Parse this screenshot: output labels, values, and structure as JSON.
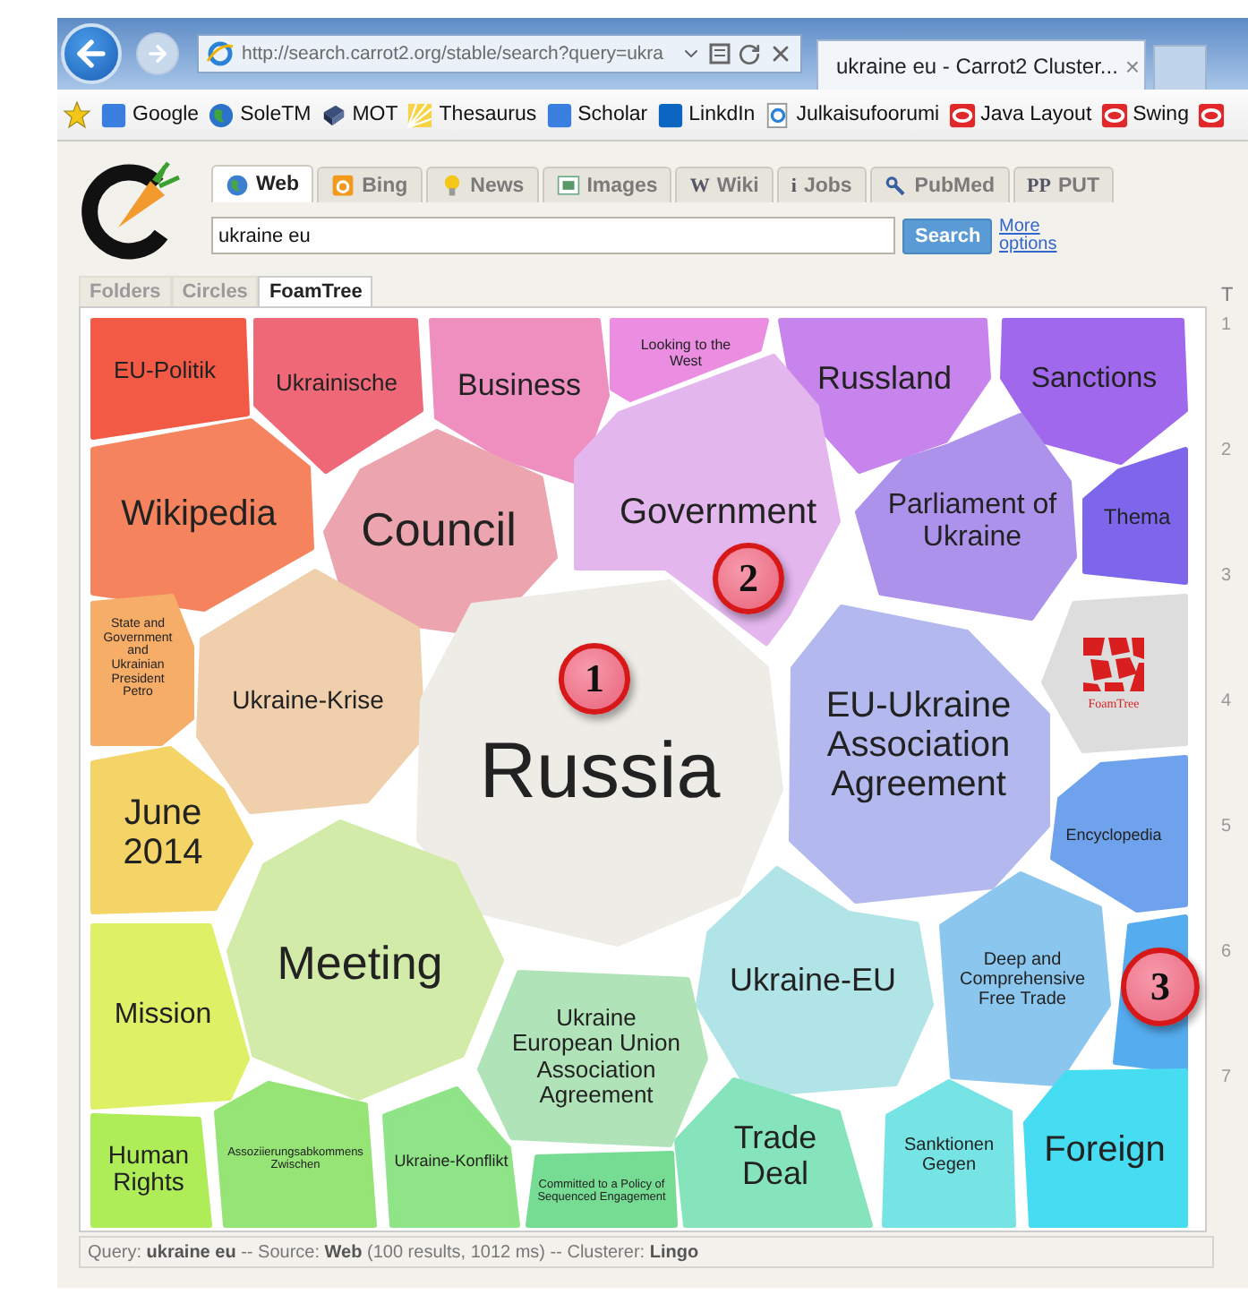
{
  "browser": {
    "address": "http://search.carrot2.org/stable/search?query=ukra",
    "tab": {
      "title": "ukraine eu - Carrot2 Cluster...",
      "close": "×"
    }
  },
  "favorites": [
    {
      "label": "Google"
    },
    {
      "label": "SoleTM"
    },
    {
      "label": "MOT"
    },
    {
      "label": "Thesaurus"
    },
    {
      "label": "Scholar"
    },
    {
      "label": "LinkdIn"
    },
    {
      "label": "Julkaisufoorumi"
    },
    {
      "label": "Java Layout"
    },
    {
      "label": "Swing"
    }
  ],
  "sources": [
    {
      "label": "Web",
      "selected": true
    },
    {
      "label": "Bing",
      "selected": false
    },
    {
      "label": "News",
      "selected": false
    },
    {
      "label": "Images",
      "selected": false
    },
    {
      "label": "Wiki",
      "selected": false,
      "icon_text": "W"
    },
    {
      "label": "Jobs",
      "selected": false,
      "icon_text": "i"
    },
    {
      "label": "PubMed",
      "selected": false
    },
    {
      "label": "PUT",
      "selected": false,
      "icon_text": "PP"
    }
  ],
  "search": {
    "value": "ukraine eu",
    "button": "Search",
    "more_options": "More options"
  },
  "views": [
    {
      "label": "Folders",
      "selected": false
    },
    {
      "label": "Circles",
      "selected": false
    },
    {
      "label": "FoamTree",
      "selected": true
    }
  ],
  "clusters": [
    {
      "kind": "cluster",
      "label": "EU-Politik",
      "color": "#f25a45"
    },
    {
      "kind": "cluster",
      "label": "Ukrainische",
      "color": "#ef6877"
    },
    {
      "kind": "cluster",
      "label": "Business",
      "color": "#ee8fc0"
    },
    {
      "kind": "cluster",
      "label": "Looking to the West",
      "color": "#eb8ee2"
    },
    {
      "kind": "cluster",
      "label": "Russland",
      "color": "#c784ec"
    },
    {
      "kind": "cluster",
      "label": "Sanctions",
      "color": "#a068ec"
    },
    {
      "kind": "cluster",
      "label": "Wikipedia",
      "color": "#f5845e"
    },
    {
      "kind": "cluster",
      "label": "Council",
      "color": "#eca4ae"
    },
    {
      "kind": "cluster",
      "label": "Government",
      "color": "#e3b6ee"
    },
    {
      "kind": "cluster",
      "label": "Parliament of Ukraine",
      "color": "#ad92ec"
    },
    {
      "kind": "cluster",
      "label": "Thema",
      "color": "#7d66ec"
    },
    {
      "kind": "cluster",
      "label": "State and Government and Ukrainian President Petro",
      "color": "#f5ad68"
    },
    {
      "kind": "cluster",
      "label": "Ukraine-Krise",
      "color": "#efcfac"
    },
    {
      "kind": "cluster",
      "label": "Russia",
      "color": "#eeece7"
    },
    {
      "kind": "cluster",
      "label": "EU-Ukraine Association Agreement",
      "color": "#b3b8ee"
    },
    {
      "kind": "logo",
      "label": "FoamTree",
      "color": "#dddddd"
    },
    {
      "kind": "cluster",
      "label": "Encyclopedia",
      "color": "#6fa2ec"
    },
    {
      "kind": "cluster",
      "label": "June 2014",
      "color": "#f4d466"
    },
    {
      "kind": "cluster",
      "label": "Meeting",
      "color": "#d3eba8"
    },
    {
      "kind": "cluster",
      "label": "Mission",
      "color": "#ddf066"
    },
    {
      "kind": "cluster",
      "label": "Ukraine European Union Association Agreement",
      "color": "#b0e4b8"
    },
    {
      "kind": "cluster",
      "label": "Ukraine-EU",
      "color": "#b0e4e6"
    },
    {
      "kind": "cluster",
      "label": "Deep and Comprehensive Free Trade",
      "color": "#8ac6ee"
    },
    {
      "kind": "blank",
      "color": "#55acee"
    },
    {
      "kind": "cluster",
      "label": "Human Rights",
      "color": "#aeec58"
    },
    {
      "kind": "cluster",
      "label": "Assoziierungsabkommens Zwischen",
      "color": "#96e476"
    },
    {
      "kind": "cluster",
      "label": "Ukraine-Konflikt",
      "color": "#8ee486"
    },
    {
      "kind": "cluster",
      "label": "Committed to a Policy of Sequenced Engagement",
      "color": "#76dc94"
    },
    {
      "kind": "cluster",
      "label": "Trade Deal",
      "color": "#86e4bc"
    },
    {
      "kind": "cluster",
      "label": "Sanktionen Gegen",
      "color": "#76e4e4"
    },
    {
      "kind": "cluster",
      "label": "Foreign",
      "color": "#46dcf2"
    }
  ],
  "callouts": [
    {
      "label": "1"
    },
    {
      "label": "2"
    },
    {
      "label": "3"
    }
  ],
  "results": {
    "heading": "T",
    "numbers": [
      "1",
      "2",
      "3",
      "4",
      "5",
      "6",
      "7"
    ]
  },
  "status": "Query: **ukraine eu** -- Source: **Web** (100 results, 1012 ms) -- Clusterer: **Lingo**"
}
